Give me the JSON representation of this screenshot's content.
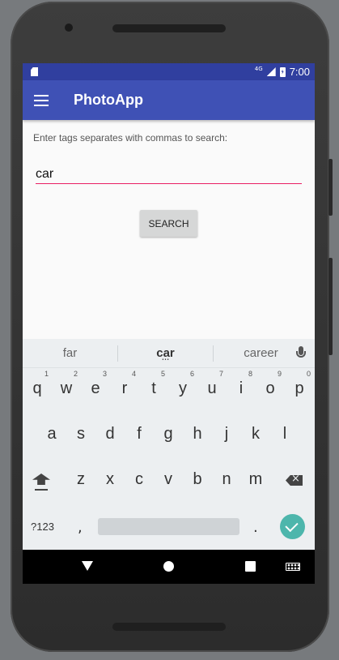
{
  "status_bar": {
    "network": "4G",
    "time": "7:00"
  },
  "app_bar": {
    "title": "PhotoApp"
  },
  "search_form": {
    "prompt": "Enter tags separates with commas to search:",
    "input_value": "car",
    "button_label": "SEARCH",
    "accent_color": "#e91e63"
  },
  "keyboard": {
    "suggestions": [
      "far",
      "car",
      "career"
    ],
    "rows": [
      [
        {
          "ch": "q",
          "hint": "1"
        },
        {
          "ch": "w",
          "hint": "2"
        },
        {
          "ch": "e",
          "hint": "3"
        },
        {
          "ch": "r",
          "hint": "4"
        },
        {
          "ch": "t",
          "hint": "5"
        },
        {
          "ch": "y",
          "hint": "6"
        },
        {
          "ch": "u",
          "hint": "7"
        },
        {
          "ch": "i",
          "hint": "8"
        },
        {
          "ch": "o",
          "hint": "9"
        },
        {
          "ch": "p",
          "hint": "0"
        }
      ],
      [
        {
          "ch": "a"
        },
        {
          "ch": "s"
        },
        {
          "ch": "d"
        },
        {
          "ch": "f"
        },
        {
          "ch": "g"
        },
        {
          "ch": "h"
        },
        {
          "ch": "j"
        },
        {
          "ch": "k"
        },
        {
          "ch": "l"
        }
      ],
      [
        {
          "ch": "z"
        },
        {
          "ch": "x"
        },
        {
          "ch": "c"
        },
        {
          "ch": "v"
        },
        {
          "ch": "b"
        },
        {
          "ch": "n"
        },
        {
          "ch": "m"
        }
      ]
    ],
    "symbols_label": "?123",
    "comma": ",",
    "period": ".",
    "enter_color": "#4db6ac"
  },
  "colors": {
    "status_bar": "#303f9f",
    "app_bar": "#3f51b5",
    "background": "#fafafa",
    "keyboard": "#eceff1"
  }
}
